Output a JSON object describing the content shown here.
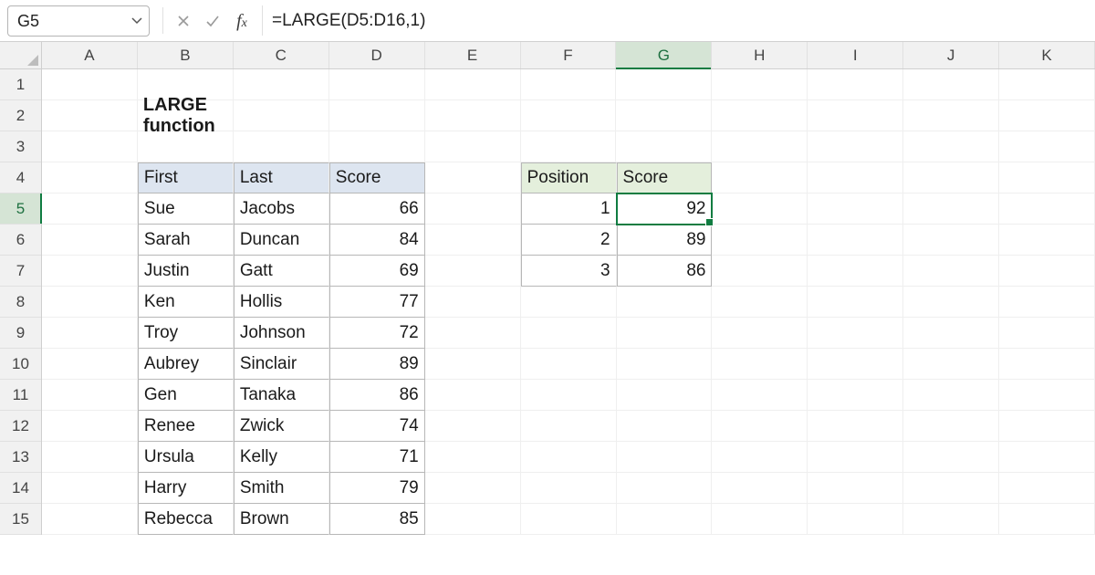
{
  "namebox": {
    "value": "G5"
  },
  "formula": "=LARGE(D5:D16,1)",
  "columns": [
    "A",
    "B",
    "C",
    "D",
    "E",
    "F",
    "G",
    "H",
    "I",
    "J",
    "K"
  ],
  "rows": [
    "1",
    "2",
    "3",
    "4",
    "5",
    "6",
    "7",
    "8",
    "9",
    "10",
    "11",
    "12",
    "13",
    "14",
    "15"
  ],
  "selected": {
    "col": "G",
    "row": "5"
  },
  "title": "LARGE function",
  "table1": {
    "headers": {
      "first": "First",
      "last": "Last",
      "score": "Score"
    },
    "rows": [
      {
        "first": "Sue",
        "last": "Jacobs",
        "score": "66"
      },
      {
        "first": "Sarah",
        "last": "Duncan",
        "score": "84"
      },
      {
        "first": "Justin",
        "last": "Gatt",
        "score": "69"
      },
      {
        "first": "Ken",
        "last": "Hollis",
        "score": "77"
      },
      {
        "first": "Troy",
        "last": "Johnson",
        "score": "72"
      },
      {
        "first": "Aubrey",
        "last": "Sinclair",
        "score": "89"
      },
      {
        "first": "Gen",
        "last": "Tanaka",
        "score": "86"
      },
      {
        "first": "Renee",
        "last": "Zwick",
        "score": "74"
      },
      {
        "first": "Ursula",
        "last": "Kelly",
        "score": "71"
      },
      {
        "first": "Harry",
        "last": "Smith",
        "score": "79"
      },
      {
        "first": "Rebecca",
        "last": "Brown",
        "score": "85"
      }
    ]
  },
  "table2": {
    "headers": {
      "position": "Position",
      "score": "Score"
    },
    "rows": [
      {
        "position": "1",
        "score": "92"
      },
      {
        "position": "2",
        "score": "89"
      },
      {
        "position": "3",
        "score": "86"
      }
    ]
  }
}
